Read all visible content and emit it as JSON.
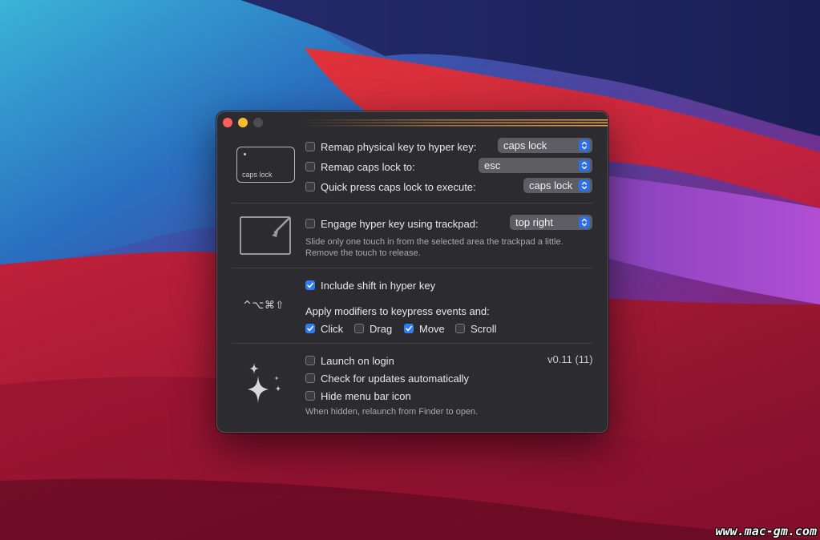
{
  "hyper_key": {
    "remap_physical": {
      "label": "Remap physical key to hyper key:",
      "checked": false,
      "value": "caps lock"
    },
    "remap_caps": {
      "label": "Remap caps lock to:",
      "checked": false,
      "value": "esc"
    },
    "quick_press": {
      "label": "Quick press caps lock to execute:",
      "checked": false,
      "value": "caps lock"
    },
    "caps_icon_label": "caps lock"
  },
  "trackpad": {
    "label": "Engage hyper key using trackpad:",
    "checked": false,
    "value": "top right",
    "note_line1": "Slide only one touch in from the selected area the trackpad a little.",
    "note_line2": "Remove the touch to release."
  },
  "modifiers": {
    "symbols": "^⌥⌘⇧",
    "include_shift": {
      "label": "Include shift in hyper key",
      "checked": true
    },
    "apply_label": "Apply modifiers to keypress events and:",
    "options": [
      {
        "label": "Click",
        "checked": true
      },
      {
        "label": "Drag",
        "checked": false
      },
      {
        "label": "Move",
        "checked": true
      },
      {
        "label": "Scroll",
        "checked": false
      }
    ]
  },
  "general": {
    "launch_on_login": {
      "label": "Launch on login",
      "checked": false
    },
    "check_updates": {
      "label": "Check for updates automatically",
      "checked": false
    },
    "hide_menu_icon": {
      "label": "Hide menu bar icon",
      "checked": false
    },
    "note": "When hidden, relaunch from Finder to open.",
    "version": "v0.11 (11)"
  },
  "watermark": "www.mac-gm.com",
  "colors": {
    "window_bg": "#2c2b2f",
    "accent": "#2f7cf6",
    "traffic_red": "#fe5f57",
    "traffic_yellow": "#febc2e"
  },
  "icons": [
    "caps-lock-key-icon",
    "trackpad-corner-icon",
    "modifier-keys-icon",
    "sparkle-icon",
    "checkmark-icon",
    "updown-chevron-icon"
  ]
}
